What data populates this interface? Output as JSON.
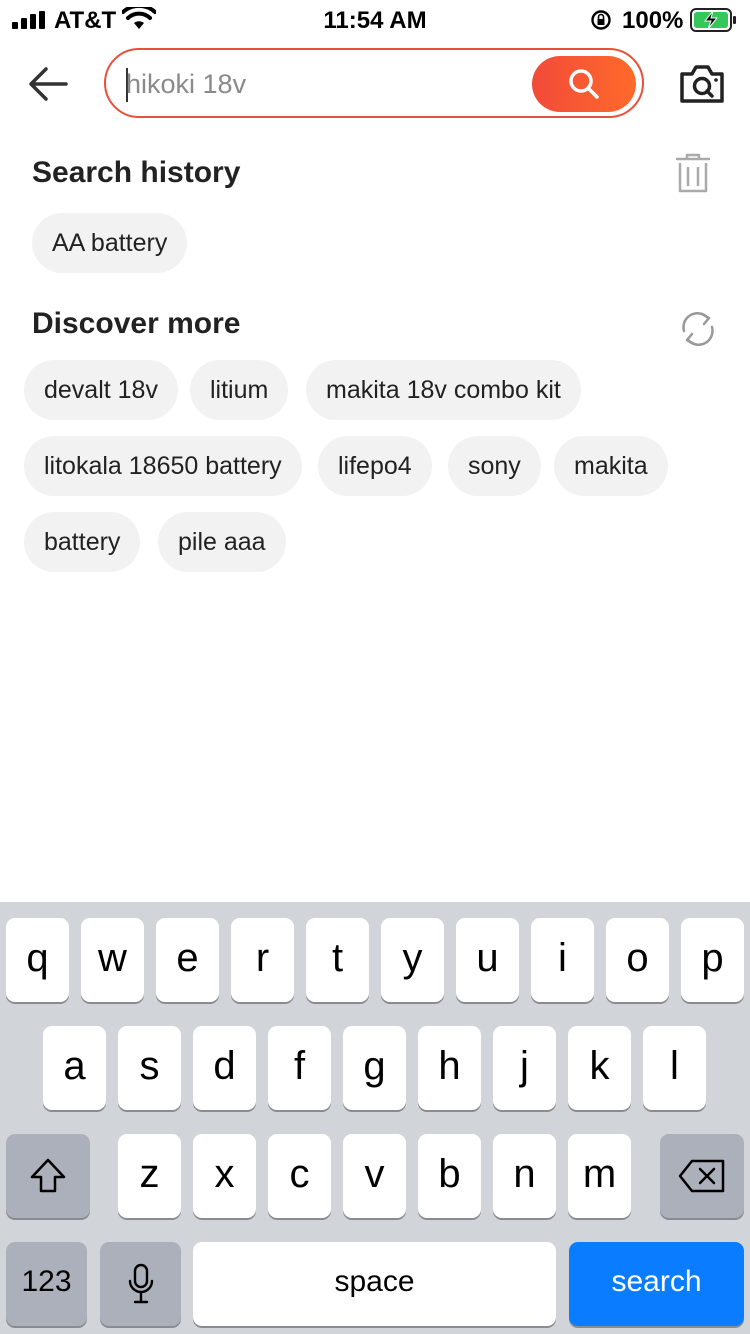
{
  "status_bar": {
    "carrier": "AT&T",
    "time": "11:54 AM",
    "battery_percent": "100%"
  },
  "search": {
    "placeholder": "hikoki 18v",
    "value": ""
  },
  "history": {
    "title": "Search history",
    "items": [
      "AA battery"
    ]
  },
  "discover": {
    "title": "Discover more",
    "items": [
      "devalt 18v",
      "litium",
      "makita 18v combo kit",
      "litokala 18650 battery",
      "lifepo4",
      "sony",
      "makita",
      "battery",
      "pile aaa"
    ]
  },
  "keyboard": {
    "row1": [
      "q",
      "w",
      "e",
      "r",
      "t",
      "y",
      "u",
      "i",
      "o",
      "p"
    ],
    "row2": [
      "a",
      "s",
      "d",
      "f",
      "g",
      "h",
      "j",
      "k",
      "l"
    ],
    "row3": [
      "z",
      "x",
      "c",
      "v",
      "b",
      "n",
      "m"
    ],
    "numbers_label": "123",
    "space_label": "space",
    "search_label": "search"
  },
  "colors": {
    "accent": "#f24a3a",
    "keyboard_bg": "#d1d4d9",
    "search_key": "#0a7cff"
  }
}
